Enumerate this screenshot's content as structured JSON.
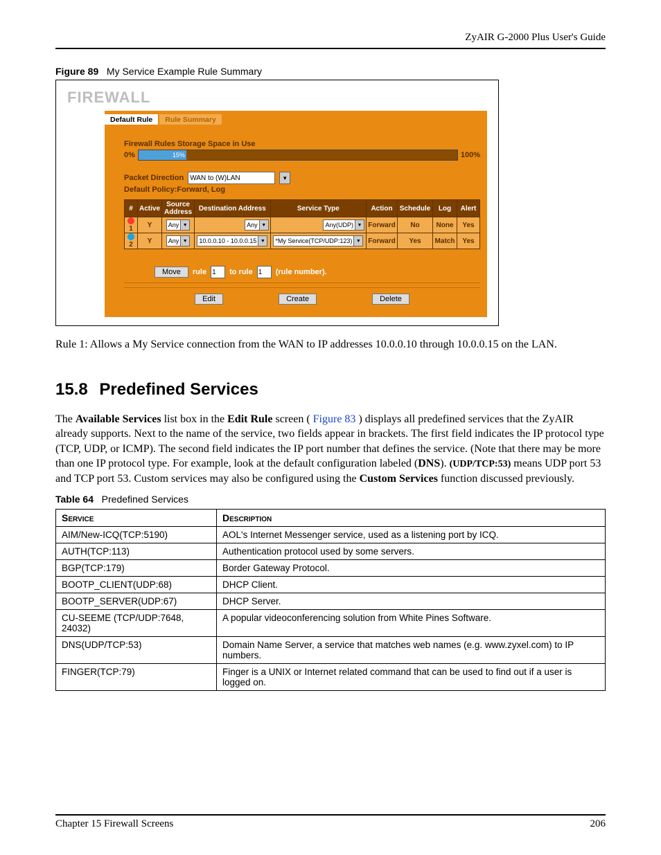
{
  "header": {
    "guide_title": "ZyAIR G-2000 Plus User's Guide"
  },
  "figure": {
    "label": "Figure 89",
    "title": "My Service Example Rule Summary"
  },
  "firewall_ui": {
    "title": "FIREWALL",
    "tabs": {
      "default_rule": "Default Rule",
      "rule_summary": "Rule Summary"
    },
    "storage_label": "Firewall Rules Storage Space in Use",
    "pct_0": "0%",
    "pct_100": "100%",
    "bar_value": "15%",
    "packet_dir_label": "Packet Direction",
    "packet_dir_value": "WAN to (W)LAN",
    "default_policy": "Default Policy:Forward, Log",
    "headers": {
      "num": "#",
      "active": "Active",
      "src": "Source Address",
      "dst": "Destination Address",
      "svc": "Service Type",
      "action": "Action",
      "sched": "Schedule",
      "log": "Log",
      "alert": "Alert"
    },
    "rows": [
      {
        "num": "1",
        "active": "Y",
        "src": "Any",
        "dst": "Any",
        "svc": "Any(UDP)",
        "action": "Forward",
        "sched": "No",
        "log": "None",
        "alert": "Yes",
        "dot": "#ff3a2e"
      },
      {
        "num": "2",
        "active": "Y",
        "src": "Any",
        "dst": "10.0.0.10 - 10.0.0.15",
        "svc": "*My Service(TCP/UDP:123)",
        "action": "Forward",
        "sched": "Yes",
        "log": "Match",
        "alert": "Yes",
        "dot": "#1aa3e8"
      }
    ],
    "move": {
      "btn": "Move",
      "rule_lbl": "rule",
      "to_rule_lbl": "to rule",
      "val1": "1",
      "val2": "1",
      "suffix": "(rule number)."
    },
    "buttons": {
      "edit": "Edit",
      "create": "Create",
      "delete": "Delete"
    }
  },
  "rule_desc": "Rule 1: Allows a My Service connection from the WAN to IP addresses 10.0.0.10 through 10.0.0.15 on the LAN.",
  "section": {
    "number": "15.8",
    "title": "Predefined Services"
  },
  "paragraph": {
    "p1a": "The ",
    "p1b": "Available Services",
    "p1c": " list box in the ",
    "p1d": "Edit Rule",
    "p1e": " screen ( ",
    "p1link": "Figure 83",
    "p1f": " ) displays all predefined services that the ZyAIR already supports. Next to the name of the service, two fields appear in brackets. The first field indicates the IP protocol type (TCP, UDP, or ICMP). The second field indicates the IP port number that defines the service. (Note that there may be more than one IP protocol type. For example, look at the default configuration labeled (",
    "p1g": "DNS",
    "p1h": "). ",
    "p1i": "(UDP/TCP:53)",
    "p1j": " means UDP port 53 and TCP port 53. Custom services may also be configured using the ",
    "p1k": "Custom Services",
    "p1l": " function discussed previously."
  },
  "table64": {
    "label": "Table 64",
    "title": "Predefined Services",
    "headers": {
      "service": "Service",
      "desc": "Description"
    },
    "rows": [
      {
        "s": "AIM/New-ICQ(TCP:5190)",
        "d": "AOL's Internet Messenger service, used as a listening port by ICQ."
      },
      {
        "s": "AUTH(TCP:113)",
        "d": "Authentication protocol used by some servers."
      },
      {
        "s": "BGP(TCP:179)",
        "d": "Border Gateway Protocol."
      },
      {
        "s": "BOOTP_CLIENT(UDP:68)",
        "d": "DHCP Client."
      },
      {
        "s": "BOOTP_SERVER(UDP:67)",
        "d": "DHCP Server."
      },
      {
        "s": "CU-SEEME (TCP/UDP:7648, 24032)",
        "d": "A popular videoconferencing solution from White Pines Software."
      },
      {
        "s": "DNS(UDP/TCP:53)",
        "d": "Domain Name Server, a service that matches web names (e.g. www.zyxel.com) to IP numbers."
      },
      {
        "s": "FINGER(TCP:79)",
        "d": "Finger is a UNIX or Internet related command that can be used to find out if a user is logged on."
      }
    ]
  },
  "footer": {
    "chapter": "Chapter 15 Firewall Screens",
    "page": "206"
  }
}
